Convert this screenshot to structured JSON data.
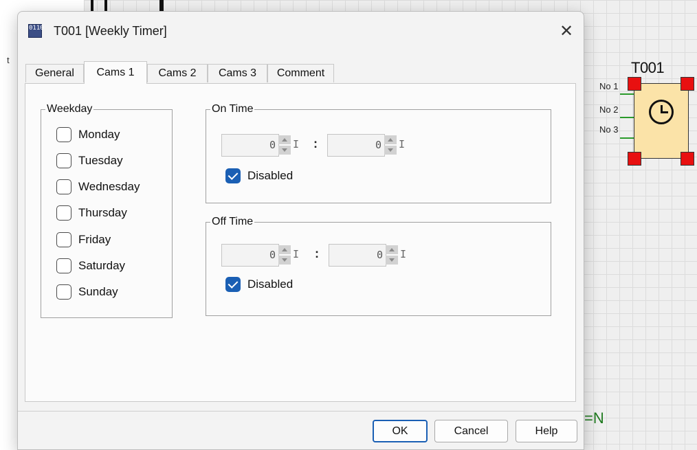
{
  "background": {
    "cut_label": "t",
    "equation_tail": "=N",
    "timer_block": {
      "title": "T001",
      "pins": [
        "No 1",
        "No 2",
        "No 3"
      ]
    }
  },
  "dialog": {
    "title": "T001 [Weekly Timer]",
    "icon_text": "0110",
    "close_glyph": "✕",
    "tabs": [
      {
        "label": "General",
        "active": false
      },
      {
        "label": "Cams 1",
        "active": true
      },
      {
        "label": "Cams 2",
        "active": false
      },
      {
        "label": "Cams 3",
        "active": false
      },
      {
        "label": "Comment",
        "active": false
      }
    ],
    "weekday": {
      "legend": "Weekday",
      "days": [
        {
          "label": "Monday",
          "checked": false
        },
        {
          "label": "Tuesday",
          "checked": false
        },
        {
          "label": "Wednesday",
          "checked": false
        },
        {
          "label": "Thursday",
          "checked": false
        },
        {
          "label": "Friday",
          "checked": false
        },
        {
          "label": "Saturday",
          "checked": false
        },
        {
          "label": "Sunday",
          "checked": false
        }
      ]
    },
    "on_time": {
      "legend": "On Time",
      "hour": "0",
      "minute": "0",
      "separator": ":",
      "cursor_glyph": "I",
      "disabled_label": "Disabled",
      "disabled_checked": true
    },
    "off_time": {
      "legend": "Off Time",
      "hour": "0",
      "minute": "0",
      "separator": ":",
      "cursor_glyph": "I",
      "disabled_label": "Disabled",
      "disabled_checked": true
    },
    "buttons": {
      "ok": "OK",
      "cancel": "Cancel",
      "help": "Help"
    }
  }
}
